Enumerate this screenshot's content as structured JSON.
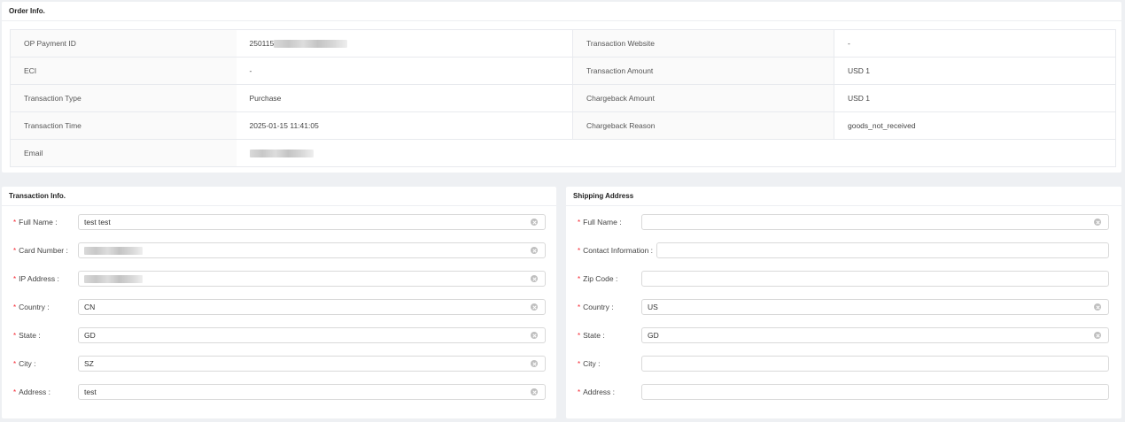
{
  "order": {
    "title": "Order Info.",
    "rows": [
      {
        "l1": "OP Payment ID",
        "v1": "250115",
        "l2": "Transaction Website",
        "v2": "-"
      },
      {
        "l1": "ECI",
        "v1": "-",
        "l2": "Transaction Amount",
        "v2": "USD 1"
      },
      {
        "l1": "Transaction Type",
        "v1": "Purchase",
        "l2": "Chargeback Amount",
        "v2": "USD 1"
      },
      {
        "l1": "Transaction Time",
        "v1": "2025-01-15 11:41:05",
        "l2": "Chargeback Reason",
        "v2": "goods_not_received"
      },
      {
        "l1": "Email",
        "v1": ""
      }
    ]
  },
  "transaction": {
    "title": "Transaction Info.",
    "fields": [
      {
        "label": "Full Name :",
        "value": "test test"
      },
      {
        "label": "Card Number :",
        "value": ""
      },
      {
        "label": "IP Address :",
        "value": ""
      },
      {
        "label": "Country :",
        "value": "CN"
      },
      {
        "label": "State :",
        "value": "GD"
      },
      {
        "label": "City :",
        "value": "SZ"
      },
      {
        "label": "Address :",
        "value": "test"
      }
    ]
  },
  "shipping": {
    "title": "Shipping Address",
    "fields": [
      {
        "label": "Full Name :",
        "value": ""
      },
      {
        "label": "Contact Information :",
        "value": ""
      },
      {
        "label": "Zip Code :",
        "value": ""
      },
      {
        "label": "Country :",
        "value": "US"
      },
      {
        "label": "State :",
        "value": "GD"
      },
      {
        "label": "City :",
        "value": ""
      },
      {
        "label": "Address :",
        "value": ""
      }
    ]
  },
  "required_mark": "*",
  "colors": {
    "required": "#f5222d",
    "border": "#d9d9d9",
    "background": "#eef0f3"
  },
  "icons": {
    "clear": "clear-circle-icon"
  }
}
